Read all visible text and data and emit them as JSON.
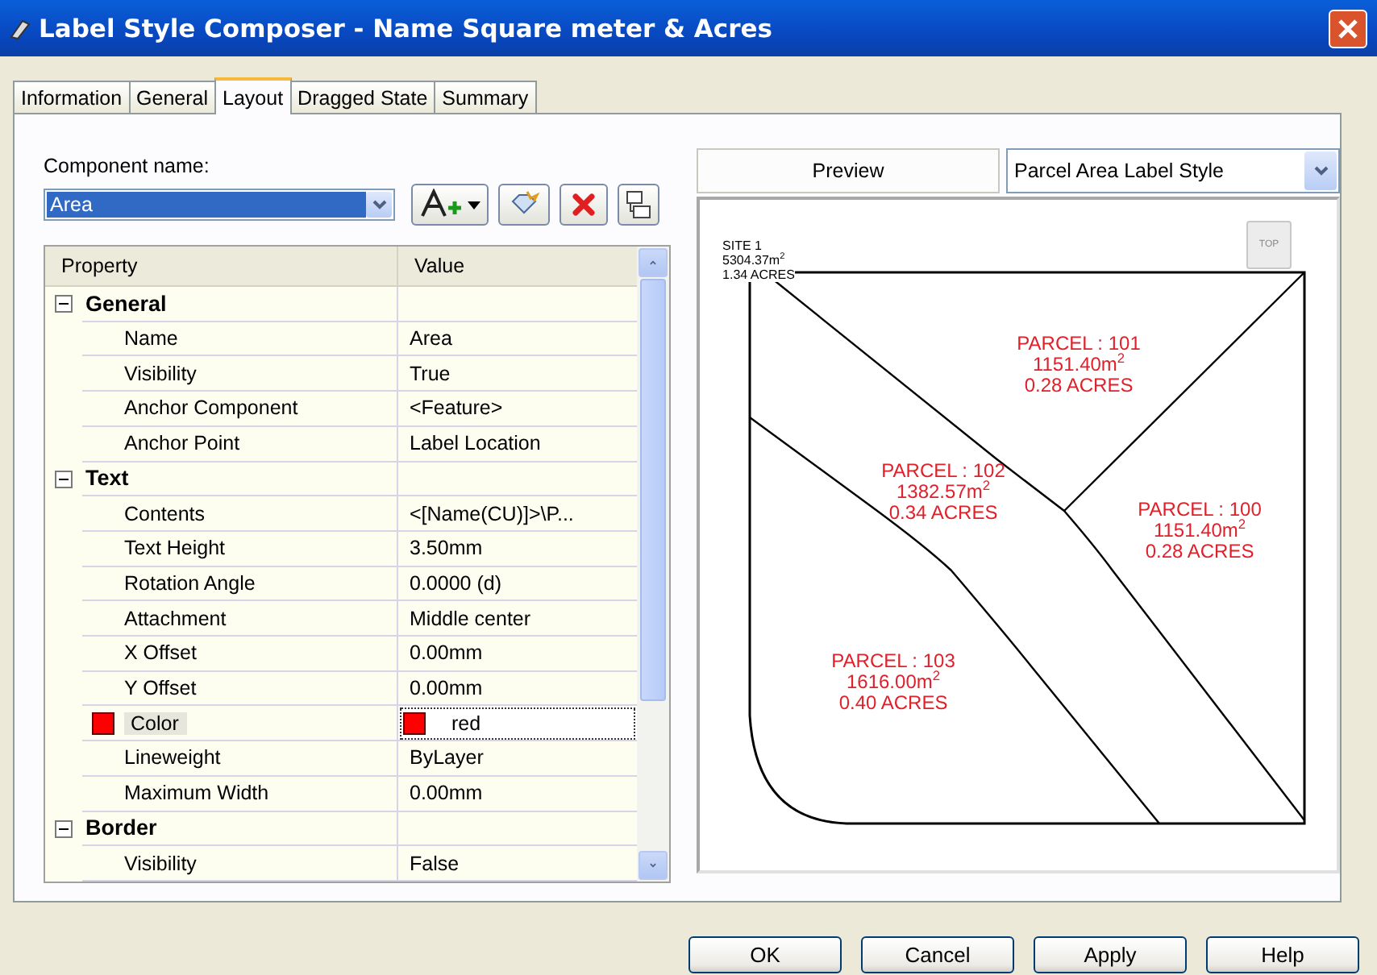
{
  "window": {
    "title": "Label Style Composer - Name Square meter & Acres"
  },
  "tabs": [
    {
      "label": "Information",
      "selected": false
    },
    {
      "label": "General",
      "selected": false
    },
    {
      "label": "Layout",
      "selected": true
    },
    {
      "label": "Dragged State",
      "selected": false
    },
    {
      "label": "Summary",
      "selected": false
    }
  ],
  "component": {
    "label": "Component name:",
    "value": "Area"
  },
  "properties": {
    "columns": [
      "Property",
      "Value"
    ],
    "groups": [
      {
        "name": "General",
        "expanded": true,
        "children": [
          {
            "name": "Name",
            "value": "Area",
            "selected": false
          },
          {
            "name": "Visibility",
            "value": "True",
            "selected": false
          },
          {
            "name": "Anchor Component",
            "value": "<Feature>",
            "selected": false
          },
          {
            "name": "Anchor Point",
            "value": "Label Location",
            "selected": false
          }
        ]
      },
      {
        "name": "Text",
        "expanded": true,
        "children": [
          {
            "name": "Contents",
            "value": "<[Name(CU)]>\\P...",
            "selected": false
          },
          {
            "name": "Text Height",
            "value": "3.50mm",
            "selected": false
          },
          {
            "name": "Rotation Angle",
            "value": "0.0000 (d)",
            "selected": false
          },
          {
            "name": "Attachment",
            "value": "Middle center",
            "selected": false
          },
          {
            "name": "X Offset",
            "value": "0.00mm",
            "selected": false
          },
          {
            "name": "Y Offset",
            "value": "0.00mm",
            "selected": false
          },
          {
            "name": "Color",
            "value": "red",
            "selected": true,
            "color": "#ff0000"
          },
          {
            "name": "Lineweight",
            "value": "ByLayer",
            "selected": false
          },
          {
            "name": "Maximum Width",
            "value": "0.00mm",
            "selected": false
          }
        ]
      },
      {
        "name": "Border",
        "expanded": true,
        "children": [
          {
            "name": "Visibility",
            "value": "False",
            "selected": false
          }
        ]
      }
    ]
  },
  "preview": {
    "label": "Preview",
    "style": "Parcel Area Label Style",
    "view_button": "TOP",
    "labels": [
      {
        "kind": "site",
        "lines": [
          "SITE 1",
          "5304.37m$^{2}$",
          "1.34 ACRES"
        ]
      },
      {
        "kind": "parcel",
        "lines": [
          "PARCEL : 101",
          "1151.40m$^{2}$",
          "0.28 ACRES"
        ]
      },
      {
        "kind": "parcel",
        "lines": [
          "PARCEL : 102",
          "1382.57m$^{2}$",
          "0.34 ACRES"
        ]
      },
      {
        "kind": "parcel",
        "lines": [
          "PARCEL : 100",
          "1151.40m$^{2}$",
          "0.28 ACRES"
        ]
      },
      {
        "kind": "parcel",
        "lines": [
          "PARCEL : 103",
          "1616.00m$^{2}$",
          "0.40 ACRES"
        ]
      }
    ]
  },
  "buttons": [
    "OK",
    "Cancel",
    "Apply",
    "Help"
  ]
}
